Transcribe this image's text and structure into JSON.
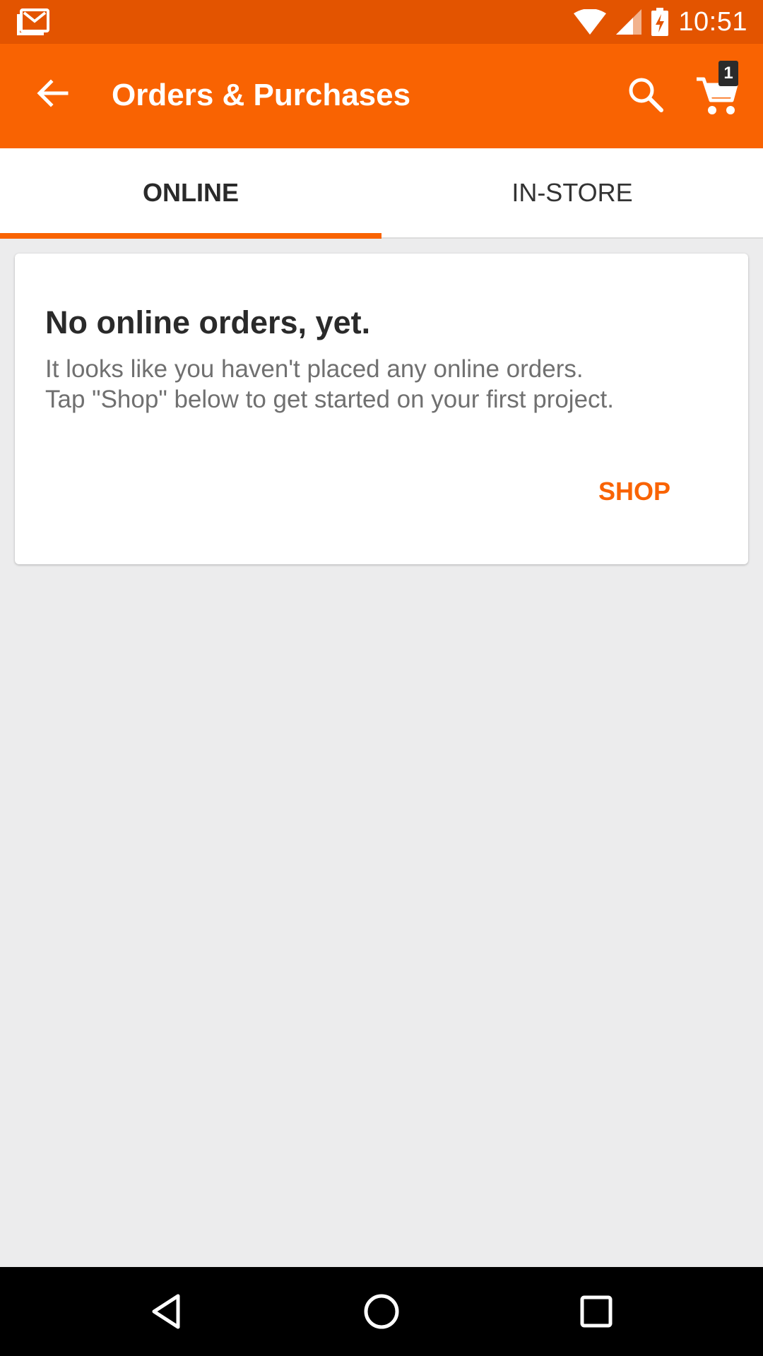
{
  "status_bar": {
    "time": "10:51",
    "icons": [
      "gmail-icon",
      "wifi-icon",
      "signal-icon",
      "battery-charging-icon"
    ]
  },
  "app_bar": {
    "title": "Orders & Purchases",
    "cart_count": "1",
    "icons": [
      "back-arrow-icon",
      "search-icon",
      "cart-icon"
    ]
  },
  "tabs": [
    {
      "label": "ONLINE",
      "active": true
    },
    {
      "label": "IN-STORE",
      "active": false
    }
  ],
  "empty_state": {
    "heading": "No online orders, yet.",
    "line1": "It looks like you haven't placed any online orders.",
    "line2": "Tap \"Shop\" below to get started on your first project.",
    "action_label": "SHOP"
  },
  "colors": {
    "brand_orange": "#f96302",
    "status_bar": "#e35400",
    "background": "#ececed"
  }
}
